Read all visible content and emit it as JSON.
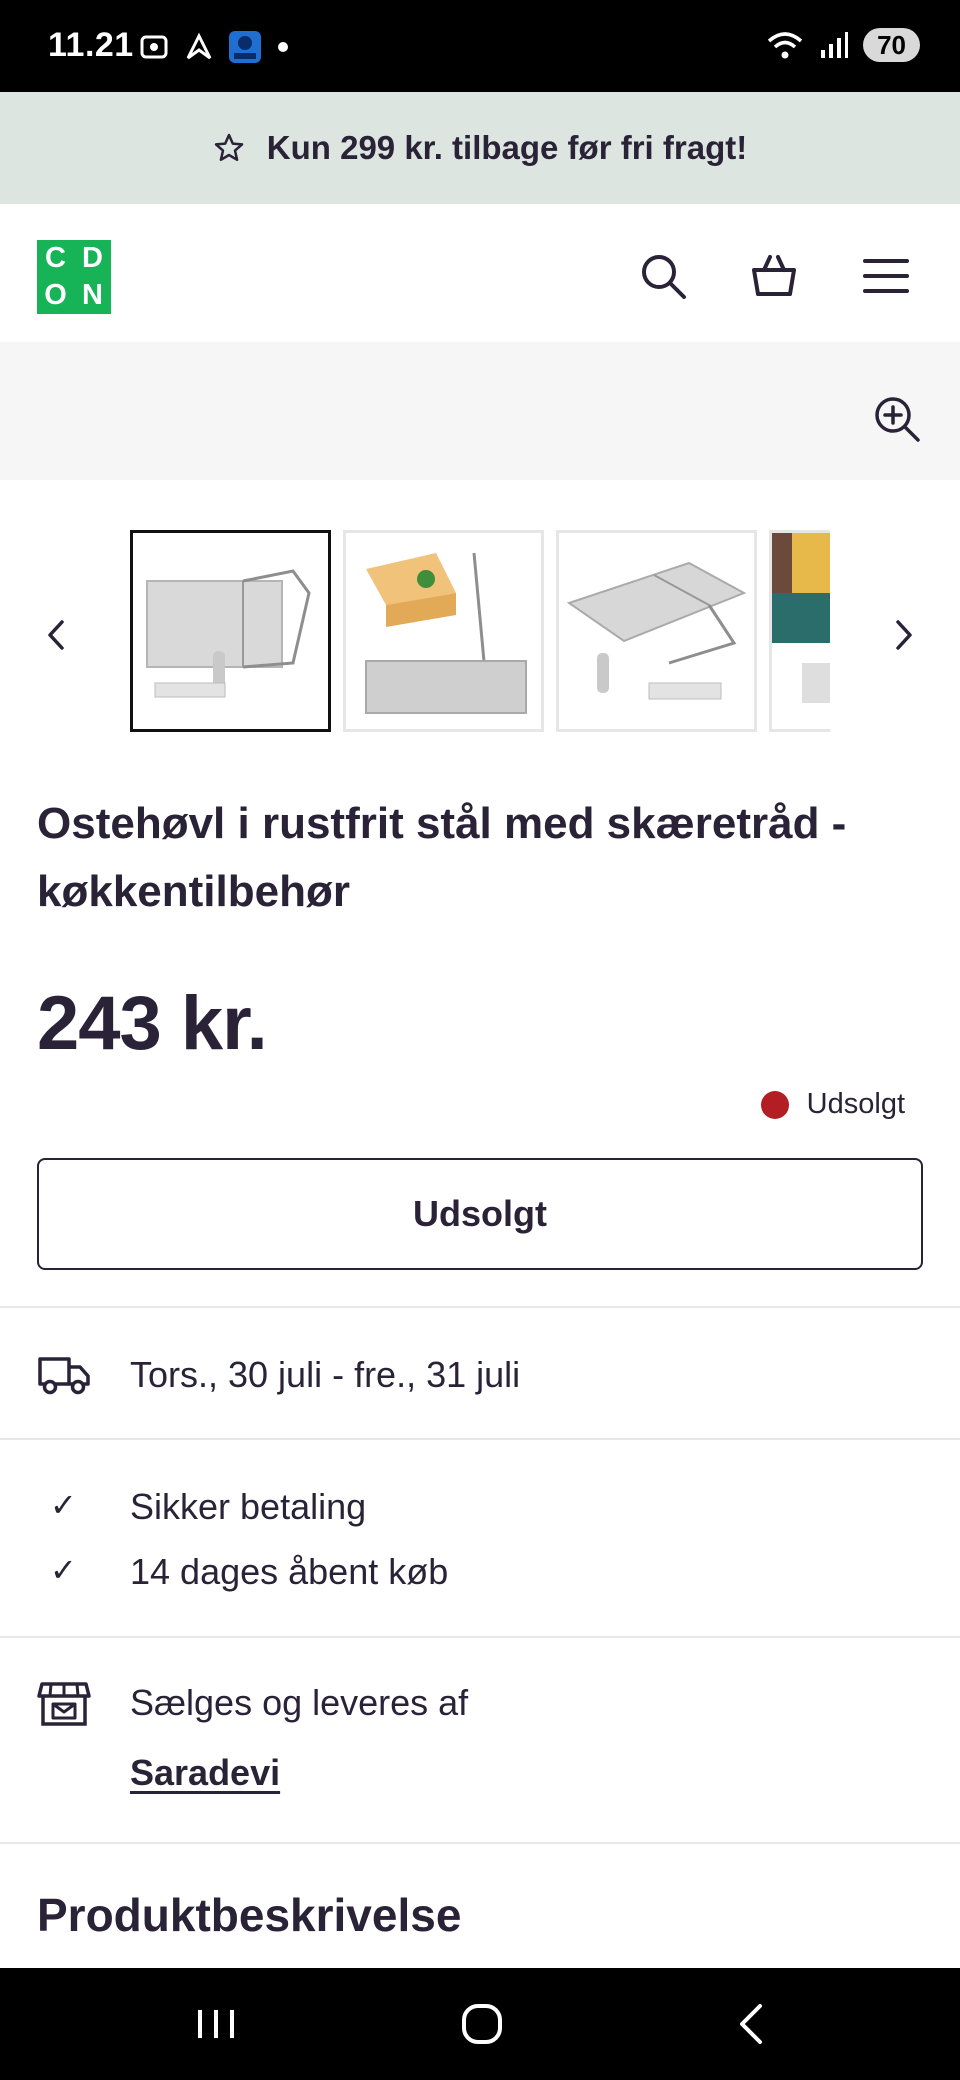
{
  "status_bar": {
    "time": "11.21",
    "battery": "70"
  },
  "promo": {
    "icon": "star-icon",
    "text": "Kun 299 kr. tilbage før fri fragt!"
  },
  "header": {
    "logo_letters": [
      "C",
      "D",
      "O",
      "N"
    ],
    "logo_color": "#16b357",
    "icons": [
      "search-icon",
      "basket-icon",
      "menu-icon"
    ]
  },
  "gallery": {
    "thumbnail_count": 4,
    "active_index": 0
  },
  "product": {
    "title": "Ostehøvl i rustfrit stål med skæretråd - køkkentilbehør",
    "price": "243 kr.",
    "stock_status": "Udsolgt",
    "stock_color": "#b21e23",
    "button_label": "Udsolgt"
  },
  "delivery": {
    "icon": "truck-icon",
    "text": "Tors., 30 juli - fre., 31 juli"
  },
  "benefits": [
    {
      "icon": "check-icon",
      "text": "Sikker betaling"
    },
    {
      "icon": "check-icon",
      "text": "14 dages åbent køb"
    }
  ],
  "seller": {
    "icon": "store-icon",
    "label": "Sælges og leveres af",
    "name": "Saradevi"
  },
  "description": {
    "heading": "Produktbeskrivelse"
  }
}
